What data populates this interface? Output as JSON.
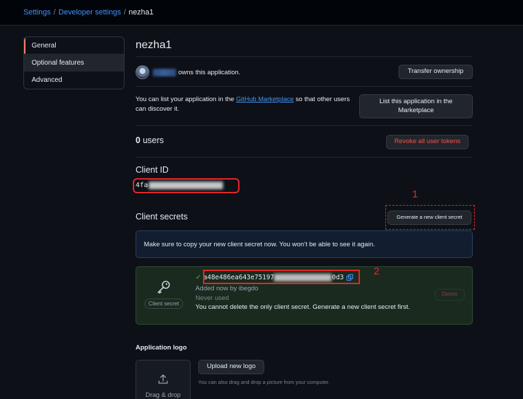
{
  "breadcrumb": {
    "items": [
      "Settings",
      "Developer settings"
    ],
    "separator": "/",
    "current": "nezha1"
  },
  "sidebar": {
    "items": [
      {
        "label": "General",
        "active": true
      },
      {
        "label": "Optional features",
        "active": false
      },
      {
        "label": "Advanced",
        "active": false
      }
    ]
  },
  "app": {
    "name": "nezha1",
    "owner_suffix": "owns this application.",
    "transfer_button": "Transfer ownership",
    "marketplace_text_before": "You can list your application in the ",
    "marketplace_link": "GitHub Marketplace",
    "marketplace_text_after": " so that other users can discover it.",
    "list_button": "List this application in the Marketplace",
    "users_count": "0",
    "users_label": "users",
    "revoke_button": "Revoke all user tokens"
  },
  "client_id": {
    "heading": "Client ID",
    "visible_prefix": "4fa"
  },
  "client_secrets": {
    "heading": "Client secrets",
    "generate_button": "Generate a new client secret",
    "flash_message": "Make sure to copy your new client secret now. You won’t be able to see it again.",
    "secret_prefix": "a48e486ea643e75197",
    "secret_suffix": "0d3",
    "added_by": "Added now by ibegdo",
    "usage": "Never used",
    "warning": "You cannot delete the only client secret. Generate a new client secret first.",
    "icon_label": "Client secret",
    "delete_button": "Delete"
  },
  "annotations": {
    "marker_1": "1",
    "marker_2": "2"
  },
  "logo": {
    "heading": "Application logo",
    "upload_button": "Upload new logo",
    "hint": "You can also drag and drop a picture from your computer.",
    "dropzone_label": "Drag & drop"
  },
  "colors": {
    "background": "#0d1117",
    "link": "#4493f8",
    "danger": "#f85149",
    "annotation_red": "#e5262b",
    "success": "#3fb950"
  }
}
